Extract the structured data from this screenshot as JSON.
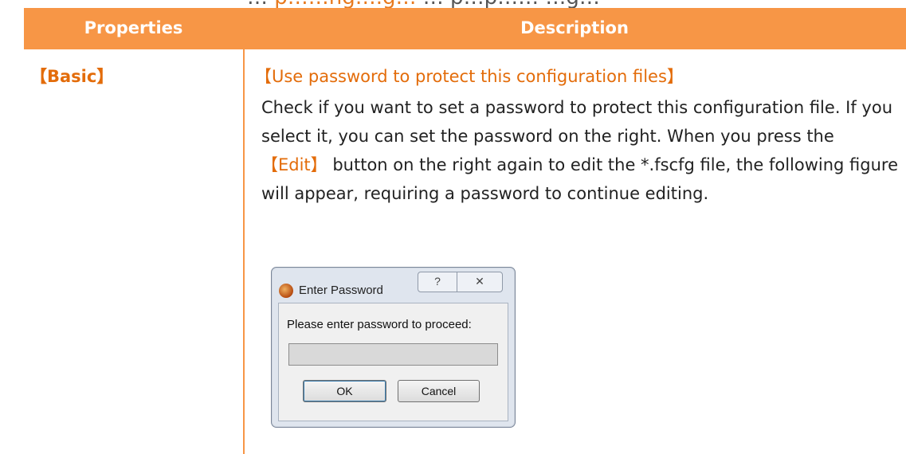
{
  "top_strip": {
    "before": "…",
    "highlight": "p……ng….g…",
    "after": "… p…p…… …g…"
  },
  "table": {
    "headers": {
      "properties": "Properties",
      "description": "Description"
    },
    "row": {
      "property": "【Basic】",
      "option_title": "【Use password to protect this configuration files】",
      "desc_part1": "Check if you want to set a password to protect this configuration file. If you select it, you can set the password on the right. When you press the ",
      "desc_kw": "【Edit】",
      "desc_part2": " button on the right again to edit the *.fscfg file, the following figure will appear, requiring a password to continue editing."
    }
  },
  "dialog": {
    "title": "Enter Password",
    "help_glyph": "?",
    "close_glyph": "✕",
    "prompt": "Please enter password to proceed:",
    "password_value": "",
    "ok_label": "OK",
    "cancel_label": "Cancel"
  },
  "colors": {
    "accent": "#f79646",
    "accent_text": "#e36c0a"
  }
}
